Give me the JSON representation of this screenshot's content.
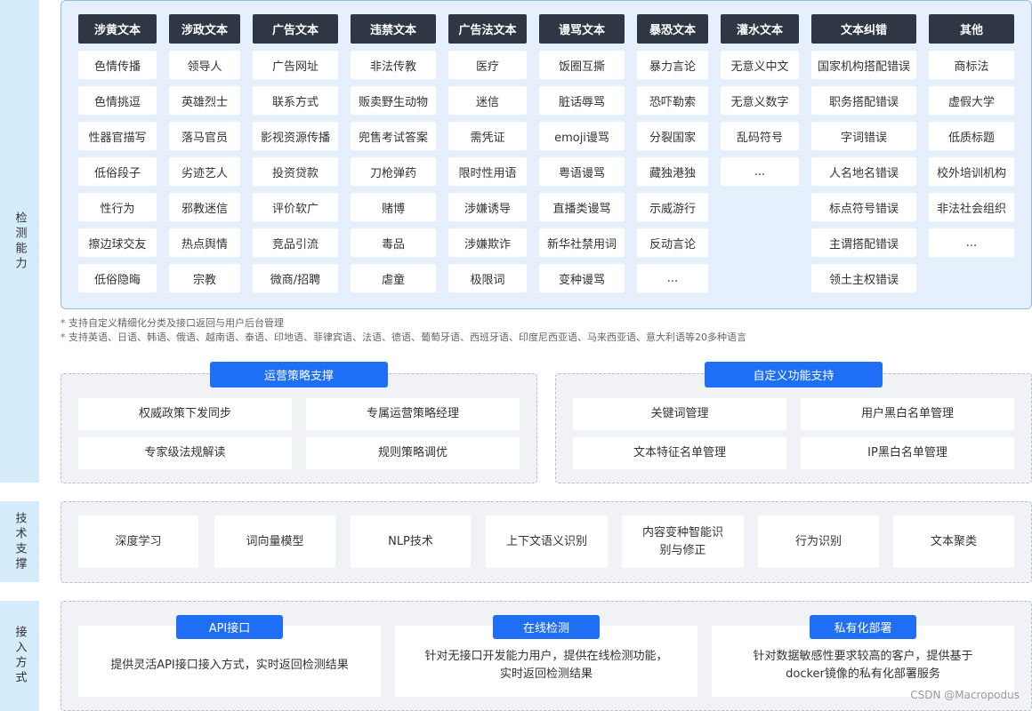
{
  "side_labels": {
    "detection": "检测能力",
    "tech": "技术支撑",
    "access": "接入方式"
  },
  "detection_columns": [
    {
      "header": "涉黄文本",
      "items": [
        "色情传播",
        "色情挑逗",
        "性器官描写",
        "低俗段子",
        "性行为",
        "擦边球交友",
        "低俗隐晦"
      ]
    },
    {
      "header": "涉政文本",
      "items": [
        "领导人",
        "英雄烈士",
        "落马官员",
        "劣迹艺人",
        "邪教迷信",
        "热点舆情",
        "宗教"
      ]
    },
    {
      "header": "广告文本",
      "items": [
        "广告网址",
        "联系方式",
        "影视资源传播",
        "投资贷款",
        "评价软广",
        "竞品引流",
        "微商/招聘"
      ]
    },
    {
      "header": "违禁文本",
      "items": [
        "非法传教",
        "贩卖野生动物",
        "兜售考试答案",
        "刀枪弹药",
        "赌博",
        "毒品",
        "虐童"
      ]
    },
    {
      "header": "广告法文本",
      "items": [
        "医疗",
        "迷信",
        "需凭证",
        "限时性用语",
        "涉嫌诱导",
        "涉嫌欺诈",
        "极限词"
      ]
    },
    {
      "header": "谩骂文本",
      "items": [
        "饭圈互撕",
        "脏话辱骂",
        "emoji谩骂",
        "粤语谩骂",
        "直播类谩骂",
        "新华社禁用词",
        "变种谩骂"
      ]
    },
    {
      "header": "暴恐文本",
      "items": [
        "暴力言论",
        "恐吓勒索",
        "分裂国家",
        "藏独港独",
        "示威游行",
        "反动言论",
        "..."
      ]
    },
    {
      "header": "灌水文本",
      "items": [
        "无意义中文",
        "无意义数字",
        "乱码符号",
        "..."
      ]
    },
    {
      "header": "文本纠错",
      "items": [
        "国家机构搭配错误",
        "职务搭配错误",
        "字词错误",
        "人名地名错误",
        "标点符号错误",
        "主谓搭配错误",
        "领土主权错误"
      ]
    },
    {
      "header": "其他",
      "items": [
        "商标法",
        "虚假大学",
        "低质标题",
        "校外培训机构",
        "非法社会组织",
        "..."
      ]
    }
  ],
  "notes": [
    "* 支持自定义精细化分类及接口返回与用户后台管理",
    "* 支持英语、日语、韩语、俄语、越南语、泰语、印地语、菲律宾语、法语、德语、葡萄牙语、西班牙语、印度尼西亚语、马来西亚语、意大利语等20多种语言"
  ],
  "ops_support": {
    "title": "运营策略支撑",
    "items": [
      "权威政策下发同步",
      "专属运营策略经理",
      "专家级法规解读",
      "规则策略调优"
    ]
  },
  "custom_support": {
    "title": "自定义功能支持",
    "items": [
      "关键词管理",
      "用户黑白名单管理",
      "文本特征名单管理",
      "IP黑白名单管理"
    ]
  },
  "tech_items": [
    "深度学习",
    "词向量模型",
    "NLP技术",
    "上下文语义识别",
    "内容变种智能识别与修正",
    "行为识别",
    "文本聚类"
  ],
  "access_methods": [
    {
      "title": "API接口",
      "desc": "提供灵活API接口接入方式，实时返回检测结果"
    },
    {
      "title": "在线检测",
      "desc": "针对无接口开发能力用户，提供在线检测功能，实时返回检测结果"
    },
    {
      "title": "私有化部署",
      "desc": "针对数据敏感性要求较高的客户，提供基于docker镜像的私有化部署服务"
    }
  ],
  "watermark": "CSDN @Macropodus"
}
